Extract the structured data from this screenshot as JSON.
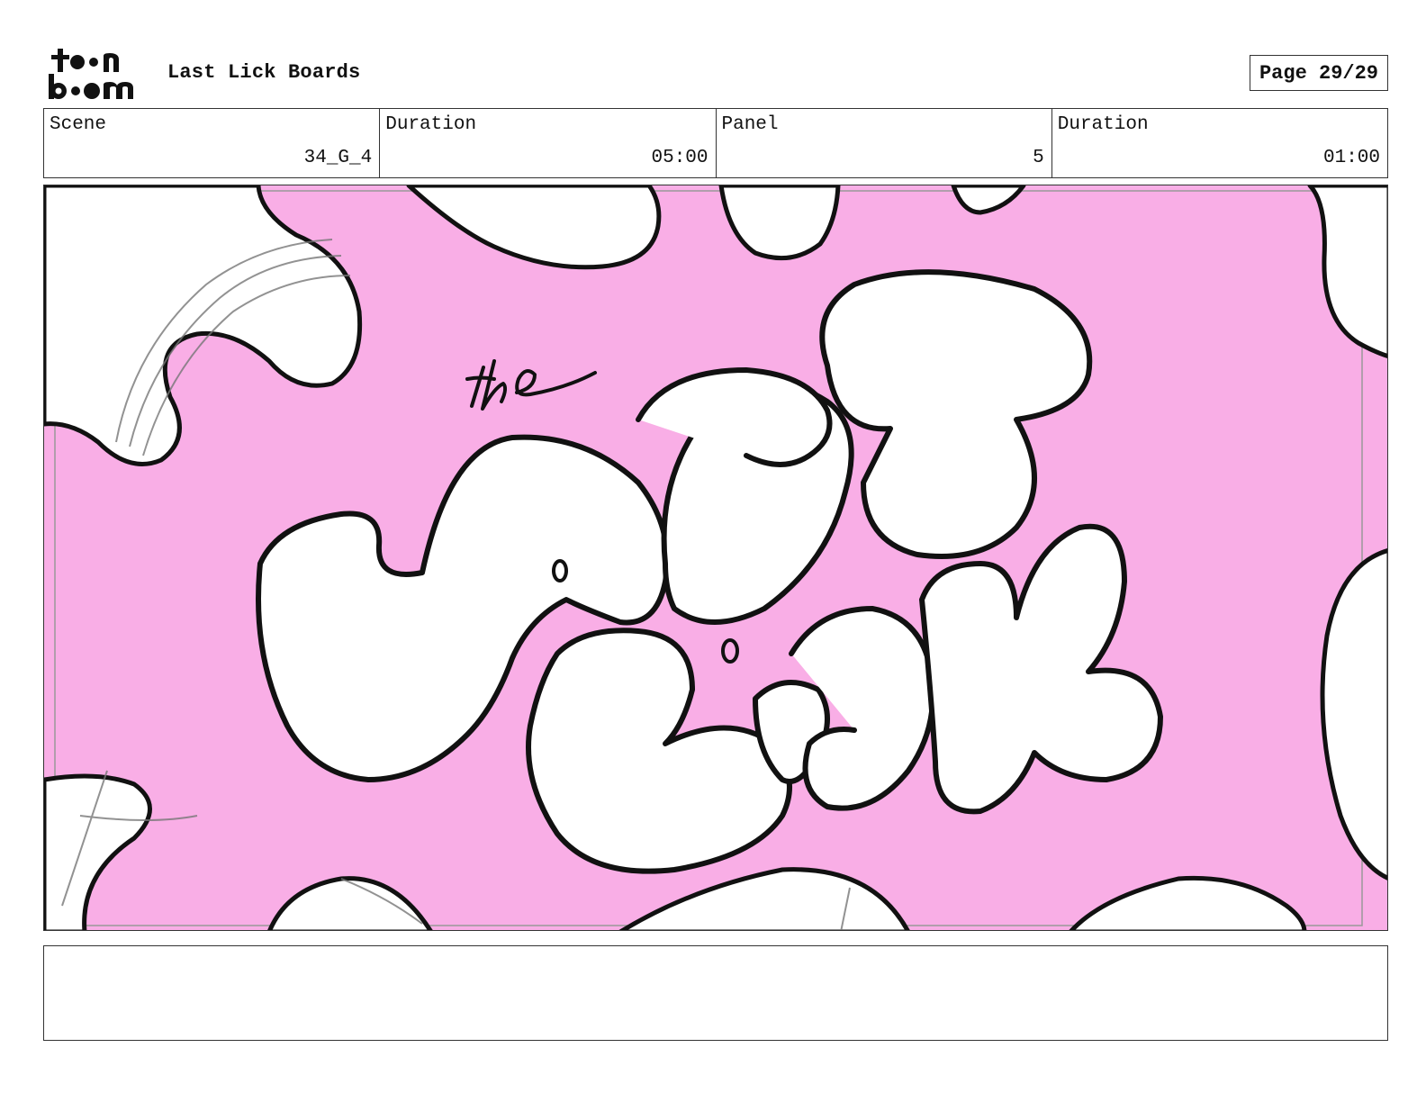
{
  "header": {
    "logo_text": "toon boom",
    "title": "Last Lick Boards",
    "page_label": "Page 29/29"
  },
  "info": [
    {
      "label": "Scene",
      "value": "34_G_4"
    },
    {
      "label": "Duration",
      "value": "05:00"
    },
    {
      "label": "Panel",
      "value": "5"
    },
    {
      "label": "Duration",
      "value": "01:00"
    }
  ],
  "panel": {
    "drawing_text_small": "the",
    "drawing_text_main": "LAST LICK",
    "background_color": "#f9aee6"
  },
  "notes": ""
}
